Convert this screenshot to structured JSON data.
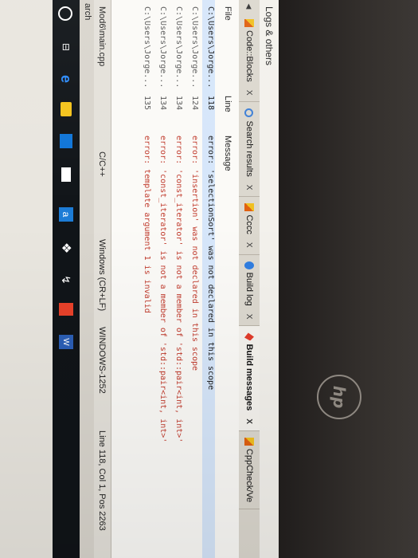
{
  "window": {
    "title": "Logs & others",
    "back_glyph": "<"
  },
  "tabs": [
    {
      "label": "Code::Blocks",
      "icon": "codeblocks-icon",
      "close": "X"
    },
    {
      "label": "Search results",
      "icon": "search-icon",
      "close": "X"
    },
    {
      "label": "Cccc",
      "icon": "codeblocks-icon",
      "close": "X"
    },
    {
      "label": "Build log",
      "icon": "build-icon",
      "close": "X"
    },
    {
      "label": "Build messages",
      "icon": "warning-icon",
      "close": "X",
      "active": true
    },
    {
      "label": "CppCheck/Ve",
      "icon": "codeblocks-icon"
    }
  ],
  "messages": {
    "headers": {
      "file": "File",
      "line": "Line",
      "message": "Message"
    },
    "rows": [
      {
        "file": "C:\\Users\\Jorge...",
        "line": "118",
        "message": "error: 'selectionSort' was not declared in this scope",
        "selected": true
      },
      {
        "file": "C:\\Users\\Jorge...",
        "line": "124",
        "message": "error: 'insertion' was not declared in this scope"
      },
      {
        "file": "C:\\Users\\Jorge...",
        "line": "134",
        "message": "error: 'const_iterator' is not a member of 'std::pair<int, int>'"
      },
      {
        "file": "C:\\Users\\Jorge...",
        "line": "134",
        "message": "error: 'const_iterator' is not a member of 'std::pair<int, int>'"
      },
      {
        "file": "C:\\Users\\Jorge...",
        "line": "135",
        "message": "error: template argument 1 is invalid"
      }
    ]
  },
  "status": {
    "file": "Mod6\\main.cpp",
    "language": "C/C++",
    "eol": "Windows (CR+LF)",
    "encoding": "WINDOWS-1252",
    "position": "Line 118, Col 1, Pos 2263"
  },
  "left_strip": {
    "label": "arch"
  },
  "taskbar": {
    "a_label": "a",
    "word_label": "W"
  },
  "bezel": {
    "logo": "hp"
  }
}
